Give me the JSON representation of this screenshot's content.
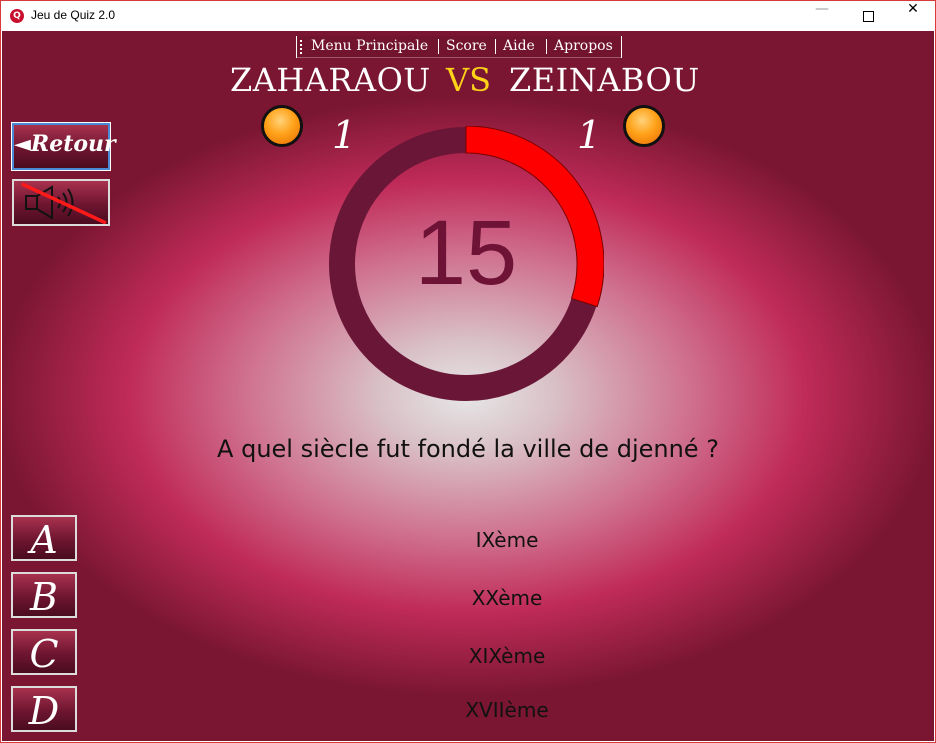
{
  "window": {
    "title": "Jeu de Quiz 2.0",
    "icon": "quiz-app-icon",
    "controls": [
      "minimize",
      "maximize",
      "close"
    ]
  },
  "menu": {
    "items": [
      {
        "label": "Menu Principale"
      },
      {
        "label": "Score"
      },
      {
        "label": "Aide"
      },
      {
        "label": "Apropos"
      }
    ]
  },
  "match": {
    "player1": "ZAHARAOU",
    "vs": "VS",
    "player2": "ZEINABOU",
    "score1": "1",
    "score2": "1"
  },
  "controls": {
    "back_label": "◄Retour",
    "sound_icon": "speaker-muted-icon"
  },
  "timer": {
    "value": "15",
    "progress_fraction": 0.3,
    "colors": {
      "elapsed": "#ff0000",
      "remaining": "#6a1636",
      "number": "#6e1236"
    }
  },
  "question": {
    "text": "A quel siècle fut fondé la ville de djenné ?"
  },
  "answers": [
    {
      "letter": "A",
      "text": "IXème"
    },
    {
      "letter": "B",
      "text": "XXème"
    },
    {
      "letter": "C",
      "text": "XIXème"
    },
    {
      "letter": "D",
      "text": "XVIIème"
    }
  ],
  "colors": {
    "vs": "#ffd21a",
    "accent_red": "#ff0000",
    "button_bg": "#6e1530",
    "window_border": "#d9393b"
  }
}
